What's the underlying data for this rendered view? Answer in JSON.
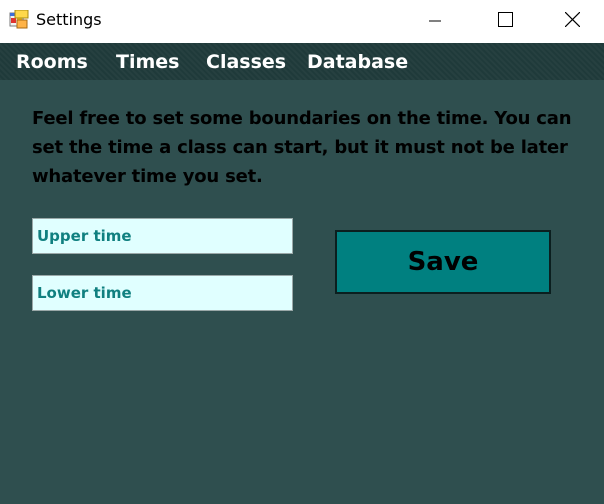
{
  "window": {
    "title": "Settings",
    "icon": "app-window-icon",
    "controls": [
      "minimize-icon",
      "maximize-icon",
      "close-icon"
    ]
  },
  "menu": {
    "items": [
      {
        "label": "Rooms"
      },
      {
        "label": "Times"
      },
      {
        "label": "Classes"
      },
      {
        "label": "Database"
      }
    ]
  },
  "main": {
    "description": "Feel free to set some boundaries on the time. You can set the time a class can start, but it must not be later whatever time you set.",
    "upper_time": {
      "value": "",
      "placeholder": "Upper time"
    },
    "lower_time": {
      "value": "",
      "placeholder": "Lower time"
    },
    "save_label": "Save"
  },
  "colors": {
    "background": "#2f4f4f",
    "menubar": "#1f3a3a",
    "input_background": "#e0ffff",
    "input_text": "#108080",
    "button": "#008080"
  }
}
